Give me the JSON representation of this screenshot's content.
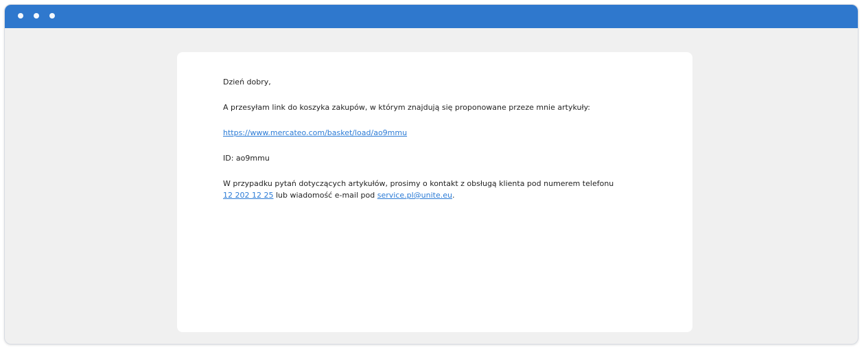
{
  "window": {
    "title_bar_color": "#2f78cd",
    "controls": [
      "dot",
      "dot",
      "dot"
    ]
  },
  "email": {
    "greeting": "Dzień dobry,",
    "intro": "A przesyłam link do koszyka zakupów, w którym znajdują się proponowane przeze mnie artykuły:",
    "basket_link": "https://www.mercateo.com/basket/load/ao9mmu",
    "id_line": "ID: ao9mmu",
    "support_text_1": "W przypadku pytań dotyczących artykułów, prosimy o kontakt z obsługą klienta pod numerem telefonu",
    "phone_link": "12 202 12 25",
    "support_text_2": " lub wiadomość e-mail pod ",
    "email_link": "service.pl@unite.eu",
    "support_text_end": ".",
    "link_color": "#2b7bd6"
  }
}
